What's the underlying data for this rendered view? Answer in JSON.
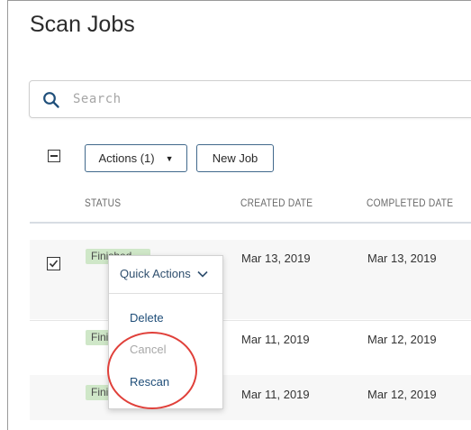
{
  "page": {
    "title": "Scan Jobs"
  },
  "search": {
    "placeholder": "Search"
  },
  "toolbar": {
    "actions_label": "Actions (1)",
    "new_job_label": "New Job"
  },
  "table": {
    "columns": [
      "STATUS",
      "CREATED DATE",
      "COMPLETED DATE"
    ],
    "rows": [
      {
        "checked": true,
        "status": "Finished",
        "created": "Mar 13, 2019",
        "completed": "Mar 13, 2019"
      },
      {
        "checked": false,
        "status": "Finished",
        "created": "Mar 11, 2019",
        "completed": "Mar 12, 2019"
      },
      {
        "checked": false,
        "status": "Finished",
        "created": "Mar 11, 2019",
        "completed": "Mar 12, 2019"
      }
    ]
  },
  "quick_actions": {
    "header": "Quick Actions",
    "items": [
      {
        "label": "Delete",
        "enabled": true
      },
      {
        "label": "Cancel",
        "enabled": false
      },
      {
        "label": "Rescan",
        "enabled": true
      }
    ]
  },
  "colors": {
    "status_finished_bg": "#cfe7c8",
    "link": "#1e4d78",
    "button_border": "#41698c",
    "annotation": "#e0403a"
  },
  "icons": {
    "search": "search-icon",
    "actions_caret": "caret-down-icon",
    "quick_actions_chevron": "chevron-down-icon",
    "row_checkbox": "checkmark-icon"
  }
}
